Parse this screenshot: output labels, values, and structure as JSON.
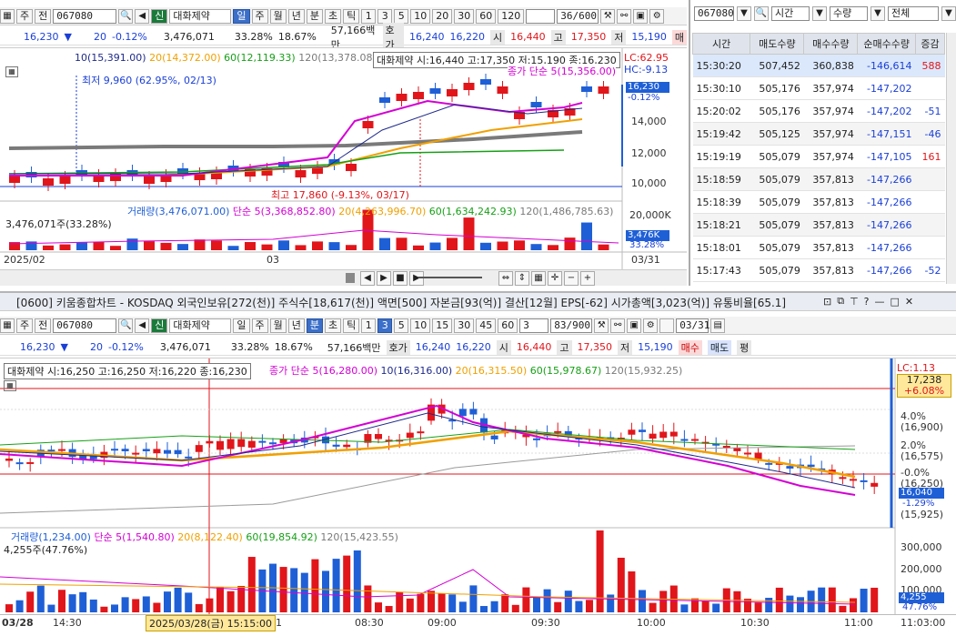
{
  "top_left": {
    "toolbar": {
      "market_type": "주",
      "prev_label": "전",
      "code": "067080",
      "sin_badge": "신",
      "name": "대화제약",
      "periods": [
        "일",
        "주",
        "월",
        "년",
        "분",
        "초",
        "틱"
      ],
      "selected_period": "일",
      "nums": [
        "1",
        "3",
        "5",
        "10",
        "20",
        "30",
        "60",
        "120"
      ],
      "count": "36/600"
    },
    "quote": {
      "price": "16,230",
      "change": "20",
      "change_pct": "-0.12%",
      "volume": "3,476,071",
      "vol_ratio": "33.28%",
      "turnover": "18.67%",
      "amount": "57,166백만",
      "ask_label": "호가",
      "ask": "16,240",
      "bid": "16,220",
      "open_label": "시",
      "open": "16,440",
      "high_label": "고",
      "high": "17,350",
      "low_label": "저",
      "low": "15,190",
      "tail": "매"
    },
    "ma_legend": {
      "ma10": "10(15,391.00)",
      "ma20": "20(14,372.00)",
      "ma60": "60(12,119.33)",
      "ma120": "120(13,378.08)",
      "info": "대화제약 시:16,440 고:17,350 저:15,190 종:16,230",
      "close_ma": "종가 단순 5(15,356.00)"
    },
    "annotations": {
      "low": "최저 9,960 (62.95%, 02/13)",
      "high": "최고 17,860 (-9.13%, 03/17)",
      "lc": "LC:62.95",
      "hc": "HC:-9.13",
      "price_tag": "16,230",
      "pct_tag": "-0.12%"
    },
    "y_ticks": [
      "14,000",
      "12,000",
      "10,000"
    ],
    "vol_legend": {
      "vol": "거래량(3,476,071.00)",
      "ma5": "단순 5(3,368,852.80)",
      "ma20": "20(4,263,996.70)",
      "ma60": "60(1,634,242.93)",
      "ma120": "120(1,486,785.63)",
      "shares": "3,476,071주(33.28%)"
    },
    "vol_ticks": [
      "20,000K"
    ],
    "vol_tag": "3,476K",
    "vol_pct": "33.28%",
    "x_labels": [
      "2025/02",
      "03",
      "03/31"
    ]
  },
  "top_right": {
    "code": "067080",
    "filter1": "시간",
    "filter2": "수량",
    "filter3": "전체",
    "query_btn": "조회",
    "headers": [
      "시간",
      "매도수량",
      "매수수량",
      "순매수수량",
      "증감"
    ],
    "rows": [
      [
        "15:30:20",
        "507,452",
        "360,838",
        "-146,614",
        "588"
      ],
      [
        "15:30:10",
        "505,176",
        "357,974",
        "-147,202",
        ""
      ],
      [
        "15:20:02",
        "505,176",
        "357,974",
        "-147,202",
        "-51"
      ],
      [
        "15:19:42",
        "505,125",
        "357,974",
        "-147,151",
        "-46"
      ],
      [
        "15:19:19",
        "505,079",
        "357,974",
        "-147,105",
        "161"
      ],
      [
        "15:18:59",
        "505,079",
        "357,813",
        "-147,266",
        ""
      ],
      [
        "15:18:39",
        "505,079",
        "357,813",
        "-147,266",
        ""
      ],
      [
        "15:18:21",
        "505,079",
        "357,813",
        "-147,266",
        ""
      ],
      [
        "15:18:01",
        "505,079",
        "357,813",
        "-147,266",
        ""
      ],
      [
        "15:17:43",
        "505,079",
        "357,813",
        "-147,266",
        "-52"
      ]
    ]
  },
  "bottom": {
    "title": "[0600] 키움종합차트 - KOSDAQ 외국인보유[272(천)] 주식수[18,617(천)] 액면[500] 자본금[93(억)] 결산[12월] EPS[-62] 시가총액[3,023(억)] 유통비율[65.1]",
    "toolbar": {
      "market_type": "주",
      "prev_label": "전",
      "code": "067080",
      "sin_badge": "신",
      "name": "대화제약",
      "periods": [
        "일",
        "주",
        "월",
        "년",
        "분",
        "초",
        "틱"
      ],
      "selected_period": "분",
      "nums": [
        "1",
        "3",
        "5",
        "10",
        "15",
        "30",
        "45",
        "60"
      ],
      "selected_num": "3",
      "interval": "3",
      "count": "83/900",
      "date": "03/31"
    },
    "quote": {
      "price": "16,230",
      "change": "20",
      "change_pct": "-0.12%",
      "volume": "3,476,071",
      "vol_ratio": "33.28%",
      "turnover": "18.67%",
      "amount": "57,166백만",
      "ask_label": "호가",
      "ask": "16,240",
      "bid": "16,220",
      "open_label": "시",
      "open": "16,440",
      "high_label": "고",
      "high": "17,350",
      "low_label": "저",
      "low": "15,190",
      "buy": "매수",
      "sell": "매도",
      "avg": "평"
    },
    "ma_legend": {
      "info": "대화제약 시:16,250 고:16,250 저:16,220 종:16,230",
      "close_ma": "종가 단순 5(16,280.00)",
      "ma10": "10(16,316.00)",
      "ma20": "20(16,315.50)",
      "ma60": "60(15,978.67)",
      "ma120": "120(15,932.25)"
    },
    "right_axis": [
      {
        "pct": "4.0%",
        "val": "(16,900)"
      },
      {
        "pct": "2.0%",
        "val": "(16,575)"
      },
      {
        "pct": "-0.0%",
        "val": "(16,250)"
      },
      {
        "pct": "-2.0%",
        "val": "(15,925)"
      }
    ],
    "lc_tag": "LC:1.13",
    "hi_tag": "17,238",
    "hi_pct": "+6.08%",
    "price_tag": "16,040",
    "pct_tag": "-1.29%",
    "vol_legend": {
      "vol": "거래량(1,234.00)",
      "ma5": "단순 5(1,540.80)",
      "ma20": "20(8,122.40)",
      "ma60": "60(19,854.92)",
      "ma120": "120(15,423.55)",
      "shares": "4,255주(47.76%)"
    },
    "vol_ticks": [
      "300,000",
      "200,000",
      "100,000"
    ],
    "vol_tag": "4,255",
    "vol_pct": "47.76%",
    "x_labels": [
      "03/28",
      "14:30",
      "31",
      "08:30",
      "09:00",
      "09:30",
      "10:00",
      "10:30",
      "11:00",
      "11:03:00"
    ],
    "cursor_label": "2025/03/28(금) 15:15:00"
  },
  "colors": {
    "up": "#e0161b",
    "down": "#1f5fd6",
    "ma5": "#d400d4",
    "ma10": "#1e2a8a",
    "ma20": "#f0a000",
    "ma60": "#16a016",
    "ma120": "#7a7a7a"
  }
}
